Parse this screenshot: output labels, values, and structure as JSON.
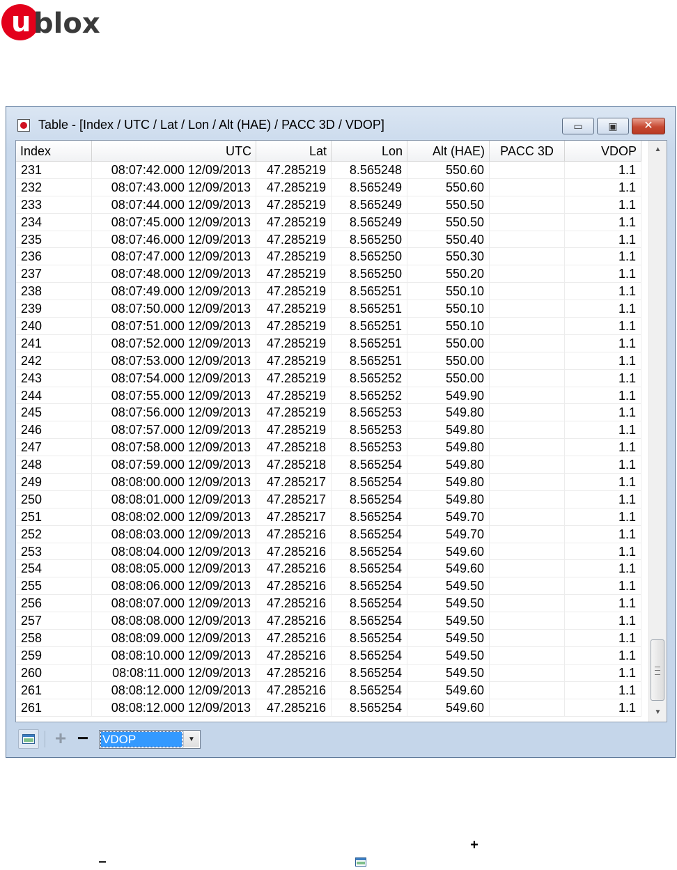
{
  "logo": {
    "u": "u",
    "text": "blox"
  },
  "window": {
    "title": "Table - [Index / UTC / Lat / Lon / Alt (HAE) / PACC 3D / VDOP]",
    "min_label": "▭",
    "max_label": "▣",
    "close_label": "✕"
  },
  "table": {
    "columns": [
      "Index",
      "UTC",
      "Lat",
      "Lon",
      "Alt (HAE)",
      "PACC 3D",
      "VDOP"
    ],
    "rows": [
      [
        "231",
        "08:07:42.000 12/09/2013",
        "47.285219",
        "8.565248",
        "550.60",
        "",
        "1.1"
      ],
      [
        "232",
        "08:07:43.000 12/09/2013",
        "47.285219",
        "8.565249",
        "550.60",
        "",
        "1.1"
      ],
      [
        "233",
        "08:07:44.000 12/09/2013",
        "47.285219",
        "8.565249",
        "550.50",
        "",
        "1.1"
      ],
      [
        "234",
        "08:07:45.000 12/09/2013",
        "47.285219",
        "8.565249",
        "550.50",
        "",
        "1.1"
      ],
      [
        "235",
        "08:07:46.000 12/09/2013",
        "47.285219",
        "8.565250",
        "550.40",
        "",
        "1.1"
      ],
      [
        "236",
        "08:07:47.000 12/09/2013",
        "47.285219",
        "8.565250",
        "550.30",
        "",
        "1.1"
      ],
      [
        "237",
        "08:07:48.000 12/09/2013",
        "47.285219",
        "8.565250",
        "550.20",
        "",
        "1.1"
      ],
      [
        "238",
        "08:07:49.000 12/09/2013",
        "47.285219",
        "8.565251",
        "550.10",
        "",
        "1.1"
      ],
      [
        "239",
        "08:07:50.000 12/09/2013",
        "47.285219",
        "8.565251",
        "550.10",
        "",
        "1.1"
      ],
      [
        "240",
        "08:07:51.000 12/09/2013",
        "47.285219",
        "8.565251",
        "550.10",
        "",
        "1.1"
      ],
      [
        "241",
        "08:07:52.000 12/09/2013",
        "47.285219",
        "8.565251",
        "550.00",
        "",
        "1.1"
      ],
      [
        "242",
        "08:07:53.000 12/09/2013",
        "47.285219",
        "8.565251",
        "550.00",
        "",
        "1.1"
      ],
      [
        "243",
        "08:07:54.000 12/09/2013",
        "47.285219",
        "8.565252",
        "550.00",
        "",
        "1.1"
      ],
      [
        "244",
        "08:07:55.000 12/09/2013",
        "47.285219",
        "8.565252",
        "549.90",
        "",
        "1.1"
      ],
      [
        "245",
        "08:07:56.000 12/09/2013",
        "47.285219",
        "8.565253",
        "549.80",
        "",
        "1.1"
      ],
      [
        "246",
        "08:07:57.000 12/09/2013",
        "47.285219",
        "8.565253",
        "549.80",
        "",
        "1.1"
      ],
      [
        "247",
        "08:07:58.000 12/09/2013",
        "47.285218",
        "8.565253",
        "549.80",
        "",
        "1.1"
      ],
      [
        "248",
        "08:07:59.000 12/09/2013",
        "47.285218",
        "8.565254",
        "549.80",
        "",
        "1.1"
      ],
      [
        "249",
        "08:08:00.000 12/09/2013",
        "47.285217",
        "8.565254",
        "549.80",
        "",
        "1.1"
      ],
      [
        "250",
        "08:08:01.000 12/09/2013",
        "47.285217",
        "8.565254",
        "549.80",
        "",
        "1.1"
      ],
      [
        "251",
        "08:08:02.000 12/09/2013",
        "47.285217",
        "8.565254",
        "549.70",
        "",
        "1.1"
      ],
      [
        "252",
        "08:08:03.000 12/09/2013",
        "47.285216",
        "8.565254",
        "549.70",
        "",
        "1.1"
      ],
      [
        "253",
        "08:08:04.000 12/09/2013",
        "47.285216",
        "8.565254",
        "549.60",
        "",
        "1.1"
      ],
      [
        "254",
        "08:08:05.000 12/09/2013",
        "47.285216",
        "8.565254",
        "549.60",
        "",
        "1.1"
      ],
      [
        "255",
        "08:08:06.000 12/09/2013",
        "47.285216",
        "8.565254",
        "549.50",
        "",
        "1.1"
      ],
      [
        "256",
        "08:08:07.000 12/09/2013",
        "47.285216",
        "8.565254",
        "549.50",
        "",
        "1.1"
      ],
      [
        "257",
        "08:08:08.000 12/09/2013",
        "47.285216",
        "8.565254",
        "549.50",
        "",
        "1.1"
      ],
      [
        "258",
        "08:08:09.000 12/09/2013",
        "47.285216",
        "8.565254",
        "549.50",
        "",
        "1.1"
      ],
      [
        "259",
        "08:08:10.000 12/09/2013",
        "47.285216",
        "8.565254",
        "549.50",
        "",
        "1.1"
      ],
      [
        "260",
        "08:08:11.000 12/09/2013",
        "47.285216",
        "8.565254",
        "549.50",
        "",
        "1.1"
      ],
      [
        "261",
        "08:08:12.000 12/09/2013",
        "47.285216",
        "8.565254",
        "549.60",
        "",
        "1.1"
      ],
      [
        "261",
        "08:08:12.000 12/09/2013",
        "47.285216",
        "8.565254",
        "549.60",
        "",
        "1.1"
      ]
    ]
  },
  "scrollbar": {
    "up_arrow": "▲",
    "down_arrow": "▼"
  },
  "toolbar": {
    "plus_label": "+",
    "minus_label": "−",
    "select_value": "VDOP",
    "select_arrow": "▼"
  },
  "footer_icons": {
    "plus": "+",
    "minus": "−"
  },
  "icons": {
    "title_icon": "app-icon",
    "table_icon": "table-view-icon",
    "add_icon": "plus-icon",
    "remove_icon": "minus-icon"
  }
}
